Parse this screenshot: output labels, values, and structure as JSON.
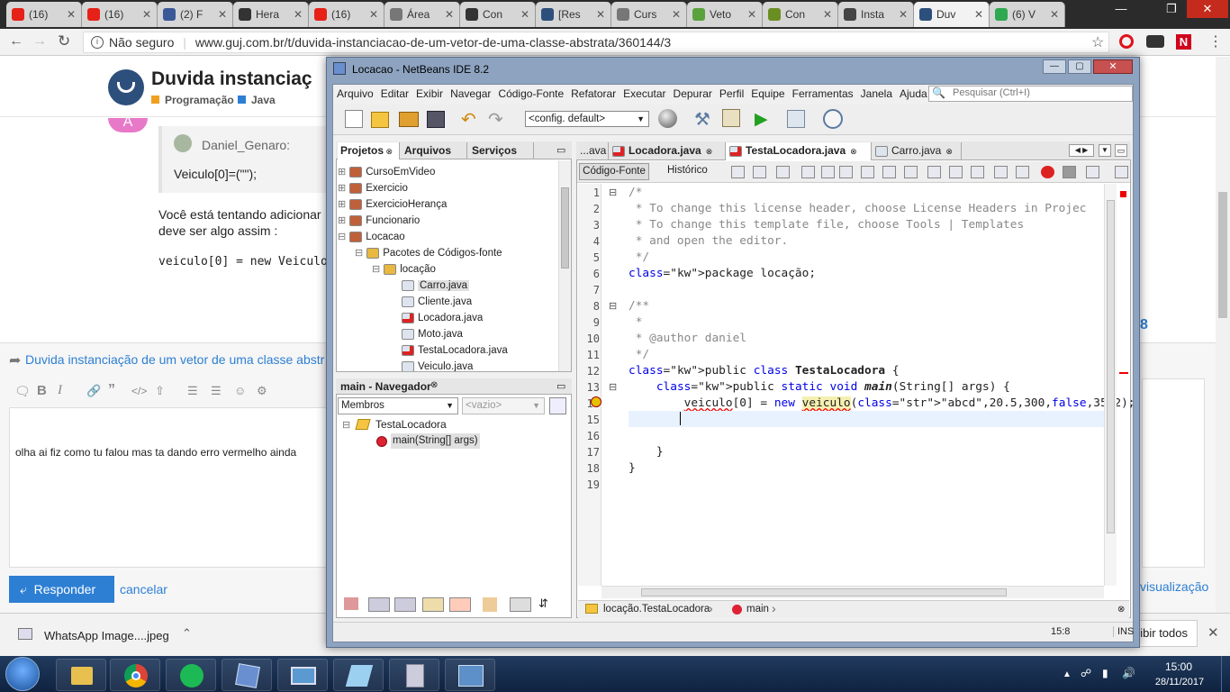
{
  "browser": {
    "tabs": [
      {
        "label": "(16)",
        "color": "#e62117"
      },
      {
        "label": "(16)",
        "color": "#e62117"
      },
      {
        "label": "(2) F",
        "color": "#3b5998"
      },
      {
        "label": "Hera",
        "color": "#333333"
      },
      {
        "label": "(16)",
        "color": "#e62117"
      },
      {
        "label": "Área",
        "color": "#777777"
      },
      {
        "label": "Con",
        "color": "#333333"
      },
      {
        "label": "[Res",
        "color": "#2d4f7c"
      },
      {
        "label": "Curs",
        "color": "#777777"
      },
      {
        "label": "Veto",
        "color": "#5aa33c"
      },
      {
        "label": "Con",
        "color": "#6b8e23"
      },
      {
        "label": "Insta",
        "color": "#444444"
      },
      {
        "label": "Duv",
        "color": "#2d4f7c"
      },
      {
        "label": "(6) V",
        "color": "#2fa84f"
      }
    ],
    "security": "Não seguro",
    "url": "www.guj.com.br/t/duvida-instanciacao-de-um-vetor-de-uma-classe-abstrata/360144/3"
  },
  "forum": {
    "title": "Duvida instanciaç",
    "category1": "Programação",
    "category2": "Java",
    "quote_author": "Daniel_Genaro:",
    "quote_text": "Veiculo[0]=(\"\");",
    "body1": "Você está tentando adicionar",
    "body2": "deve ser algo assim :",
    "code": "veiculo[0] = new Veiculo",
    "avatar_letter": "A",
    "count": "8",
    "reply_link": "Duvida instanciação de um vetor de uma classe abstr",
    "editor_text": "olha ai fiz como tu falou mas ta dando erro vermelho ainda",
    "reply_button": "Responder",
    "cancel": "cancelar",
    "visualizacao": "visualização"
  },
  "downloads": {
    "file": "WhatsApp Image....jpeg",
    "show_all": "Exibir todos"
  },
  "netbeans": {
    "title": "Locacao - NetBeans IDE 8.2",
    "menu": [
      "Arquivo",
      "Editar",
      "Exibir",
      "Navegar",
      "Código-Fonte",
      "Refatorar",
      "Executar",
      "Depurar",
      "Perfil",
      "Equipe",
      "Ferramentas",
      "Janela",
      "Ajuda"
    ],
    "search_placeholder": "Pesquisar (Ctrl+I)",
    "config": "<config. default>",
    "panel_tabs": [
      "Projetos",
      "Arquivos",
      "Serviços"
    ],
    "tree": [
      "CursoEmVideo",
      "Exercicio",
      "ExercicioHerança",
      "Funcionario",
      "Locacao",
      "Pacotes de Códigos-fonte",
      "locação",
      "Carro.java",
      "Cliente.java",
      "Locadora.java",
      "Moto.java",
      "TestaLocadora.java",
      "Veiculo.java"
    ],
    "navigator_title": "main - Navegador",
    "navigator_filter": "Membros",
    "navigator_empty": "<vazio>",
    "navigator_items": [
      "TestaLocadora",
      "main(String[] args)"
    ],
    "editor_tabs": [
      "...ava",
      "Locadora.java",
      "TestaLocadora.java",
      "Carro.java"
    ],
    "editor_modes": [
      "Código-Fonte",
      "Histórico"
    ],
    "code_lines": [
      "/*",
      " * To change this license header, choose License Headers in Projec",
      " * To change this template file, choose Tools | Templates",
      " * and open the editor.",
      " */",
      "package locação;",
      "",
      "/**",
      " *",
      " * @author daniel",
      " */",
      "public class TestaLocadora {",
      "    public static void main(String[] args) {",
      "        veiculo[0] = new veiculo(\"abcd\",20.5,300,false,35.2);",
      "",
      "",
      "    }",
      "}",
      ""
    ],
    "breadcrumb": [
      "locação.TestaLocadora",
      "main"
    ],
    "status_pos": "15:8",
    "status_mode": "INS"
  },
  "taskbar": {
    "time": "15:00",
    "date": "28/11/2017"
  }
}
